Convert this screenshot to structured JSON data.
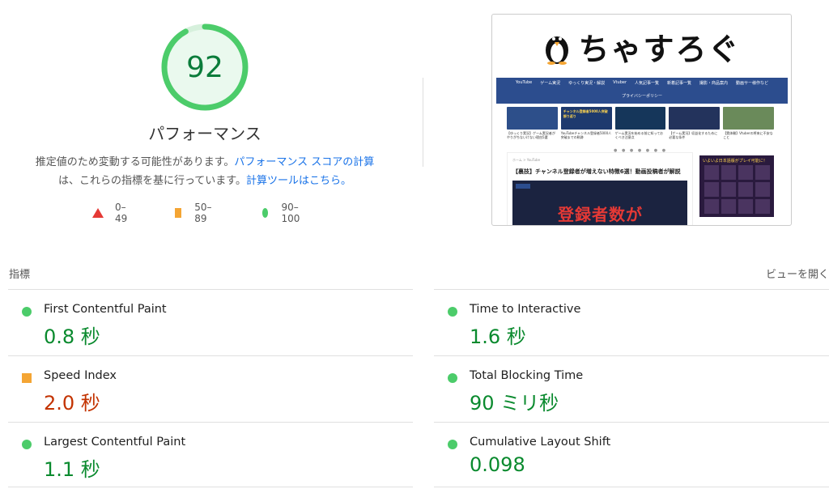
{
  "summary": {
    "score": "92",
    "title": "パフォーマンス",
    "desc_part1": "推定値のため変動する可能性があります。",
    "desc_link1": "パフォーマンス スコアの計算",
    "desc_part2": "は、これらの指標を基に行っています。",
    "desc_link2": "計算ツールはこちら。",
    "score_fraction": 0.92,
    "link_color": "#1a73e8",
    "pass_color": "#0a8a2e"
  },
  "legend": {
    "fail": "0–49",
    "average": "50–89",
    "pass": "90–100",
    "fail_icon": "red-triangle-icon",
    "average_icon": "orange-square-icon",
    "pass_icon": "green-circle-icon"
  },
  "thumbnail": {
    "logo": "ちゃすろぐ",
    "nav": [
      "YouTube",
      "ゲーム実況",
      "ゆっくり実況・解説",
      "Vtuber",
      "人気記事一覧",
      "新着記事一覧",
      "撮影・商品案内",
      "動画サー様作など"
    ],
    "nav2": "プライバシーポリシー",
    "cards": [
      "【ゆっくり実況】ゲーム実況者がやりがちないけない理由5選",
      "YouTubeチャンネル登録者5000人突破までの軌跡",
      "ゲーム実況を始める前に知っておくべき注意点",
      "【ゲーム実況】収益化するために必要な条件",
      "【実体験】Vtuberの将来に不安なこと"
    ],
    "card_badge": "チャンネル登録者5000人突破 振り返り",
    "crumb": "ホーム > YouTube",
    "article_title": "【裏技】チャンネル登録者が増えない特徴6選！動画投稿者が解説",
    "hero_text": "登録者数が",
    "side_title": "いよいよ日本語版がプレイ可能に！"
  },
  "metrics": {
    "section_label": "指標",
    "expand_label": "ビューを開く",
    "fcp": {
      "name": "First Contentful Paint",
      "value": "0.8 秒"
    },
    "tti": {
      "name": "Time to Interactive",
      "value": "1.6 秒"
    },
    "si": {
      "name": "Speed Index",
      "value": "2.0 秒"
    },
    "tbt": {
      "name": "Total Blocking Time",
      "value": "90 ミリ秒"
    },
    "lcp": {
      "name": "Largest Contentful Paint",
      "value": "1.1 秒"
    },
    "cls": {
      "name": "Cumulative Layout Shift",
      "value": "0.098"
    }
  }
}
